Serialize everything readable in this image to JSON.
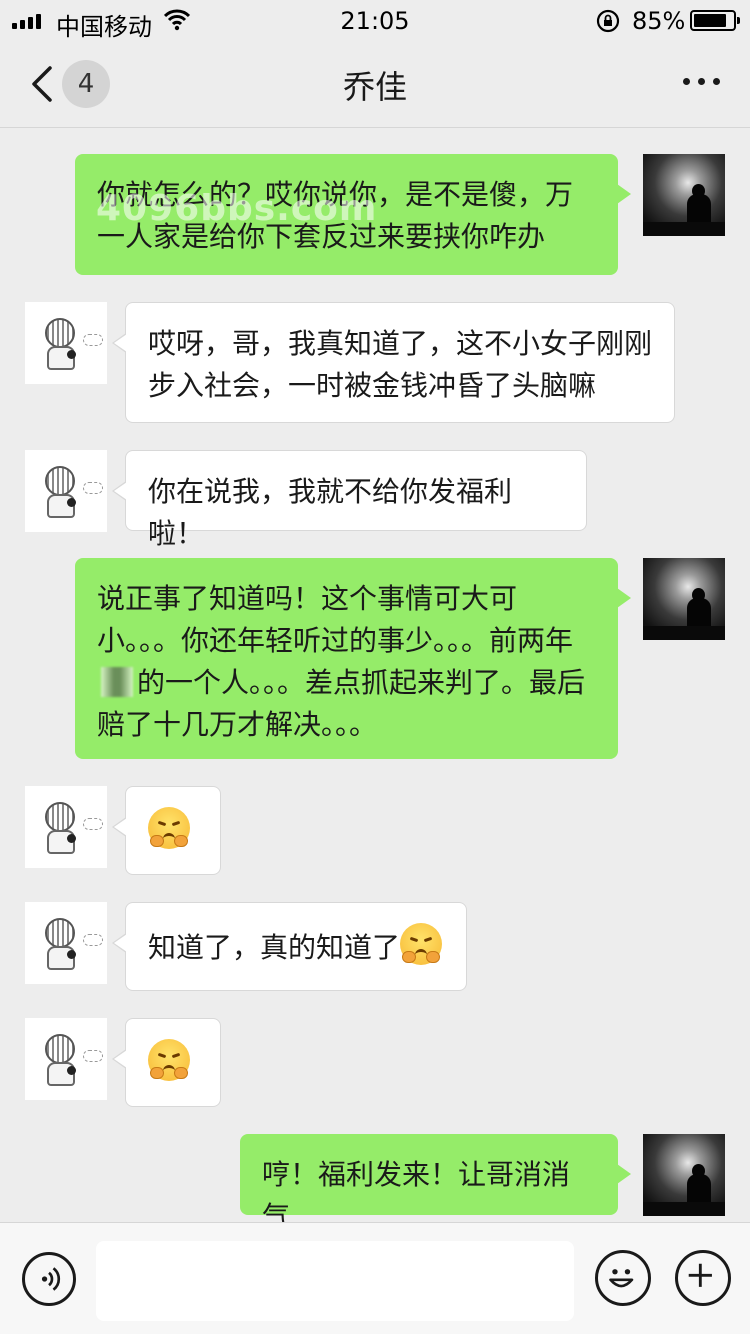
{
  "status_bar": {
    "carrier": "中国移动",
    "time": "21:05",
    "battery_percent": "85%",
    "battery_level": 0.85,
    "icons": [
      "signal-icon",
      "wifi-icon",
      "rotation-lock-icon",
      "battery-icon"
    ]
  },
  "nav": {
    "back_icon": "chevron-left-icon",
    "unread_count": "4",
    "title": "乔佳",
    "more_icon": "more-dots-icon"
  },
  "messages": [
    {
      "sender": "me",
      "text": "你就怎么的？哎你说你，是不是傻，万一人家是给你下套反过来要挟你咋办"
    },
    {
      "sender": "her",
      "text": "哎呀，哥，我真知道了，这不小女子刚刚步入社会，一时被金钱冲昏了头脑嘛"
    },
    {
      "sender": "her",
      "text": "你在说我，我就不给你发福利啦！"
    },
    {
      "sender": "me",
      "text_before": "说正事了知道吗！这个事情可大可小。。。你还年轻听过的事少。。。前两年",
      "text_after": "的一个人。。。差点抓起来判了。最后赔了十几万才解决。。。"
    },
    {
      "sender": "her",
      "emoji": "pleading-face-emoji"
    },
    {
      "sender": "her",
      "text": "知道了，真的知道了",
      "emoji": "pleading-face-emoji"
    },
    {
      "sender": "her",
      "emoji": "pleading-face-emoji"
    },
    {
      "sender": "me",
      "text": "哼！福利发来！让哥消消气"
    }
  ],
  "watermark": "4096bbs.com",
  "input_bar": {
    "text_value": "",
    "voice_icon": "voice-icon",
    "emoji_icon": "smiley-icon",
    "plus_icon": "plus-icon"
  },
  "colors": {
    "background": "#ededed",
    "my_bubble": "#95ec69",
    "their_bubble": "#ffffff"
  }
}
